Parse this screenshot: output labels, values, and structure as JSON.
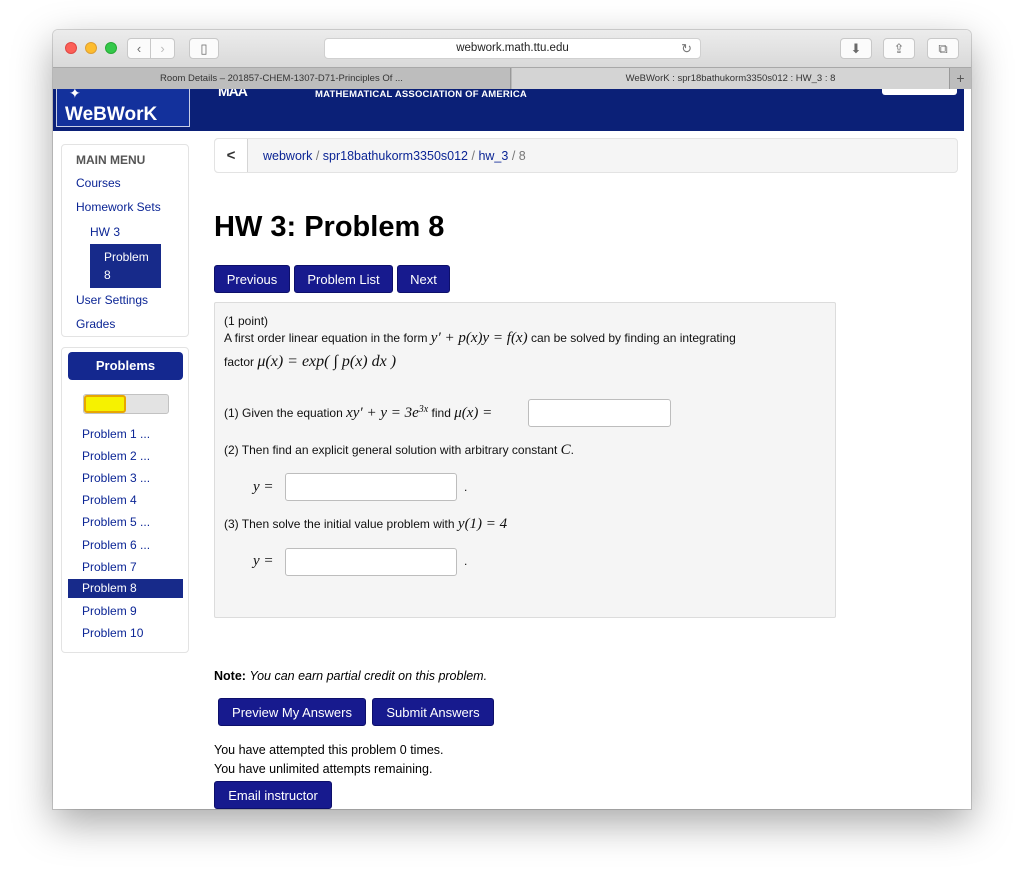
{
  "browser": {
    "url": "webwork.math.ttu.edu",
    "tabs": [
      {
        "label": "Room Details – 201857-CHEM-1307-D71-Principles Of ..."
      },
      {
        "label": "WeBWorK : spr18bathukorm3350s012 : HW_3 : 8"
      }
    ],
    "icons": {
      "back": "‹",
      "forward": "›",
      "reload": "↻",
      "add_tab": "+",
      "download": "⬇",
      "share": "⇪",
      "tabs": "⧉",
      "sidebar": "▯"
    }
  },
  "header": {
    "logo": "WeBWorK",
    "maa_logo": "MAA",
    "maa_text": "MATHEMATICAL ASSOCIATION OF AMERICA"
  },
  "main_menu": {
    "title": "MAIN MENU",
    "items": [
      {
        "label": "Courses"
      },
      {
        "label": "Homework Sets"
      },
      {
        "label": "HW 3"
      },
      {
        "label": "Problem 8"
      },
      {
        "label": "User Settings"
      },
      {
        "label": "Grades"
      }
    ]
  },
  "problems_panel": {
    "title": "Problems",
    "progress": 0.5,
    "items": [
      {
        "label": "Problem 1 ..."
      },
      {
        "label": "Problem 2 ..."
      },
      {
        "label": "Problem 3 ..."
      },
      {
        "label": "Problem 4"
      },
      {
        "label": "Problem 5 ..."
      },
      {
        "label": "Problem 6 ..."
      },
      {
        "label": "Problem 7"
      },
      {
        "label": "Problem 8"
      },
      {
        "label": "Problem 9"
      },
      {
        "label": "Problem 10"
      }
    ]
  },
  "breadcrumb": {
    "back": "<",
    "items": [
      "webwork",
      "spr18bathukorm3350s012",
      "hw_3",
      "8"
    ],
    "separator": "/"
  },
  "page_title": "HW 3: Problem 8",
  "nav_buttons": {
    "previous": "Previous",
    "problem_list": "Problem List",
    "next": "Next"
  },
  "problem": {
    "points": "(1 point)",
    "intro_a": "A first order linear equation in the form",
    "intro_eq": "y′ + p(x)y = f(x)",
    "intro_b": "can be solved by finding an integrating",
    "factor_label": "factor",
    "factor_eq": "μ(x) = exp( ∫ p(x) dx )",
    "q1_a": "(1) Given the equation",
    "q1_eq": "xy′ + y = 3e",
    "q1_exp": "3x",
    "q1_b": "find",
    "q1_mu": "μ(x) =",
    "q2": "(2) Then find an explicit general solution with arbitrary constant",
    "q2_c": "C",
    "y_eq": "y =",
    "q3": "(3) Then solve the initial value problem with",
    "q3_eq": "y(1) = 4",
    "answers": [
      "",
      "",
      ""
    ]
  },
  "note_label": "Note:",
  "note_text": "You can earn partial credit on this problem.",
  "actions": {
    "preview": "Preview My Answers",
    "submit": "Submit Answers"
  },
  "attempts": {
    "line1": "You have attempted this problem 0 times.",
    "line2": "You have unlimited attempts remaining."
  },
  "email_instructor": "Email instructor"
}
